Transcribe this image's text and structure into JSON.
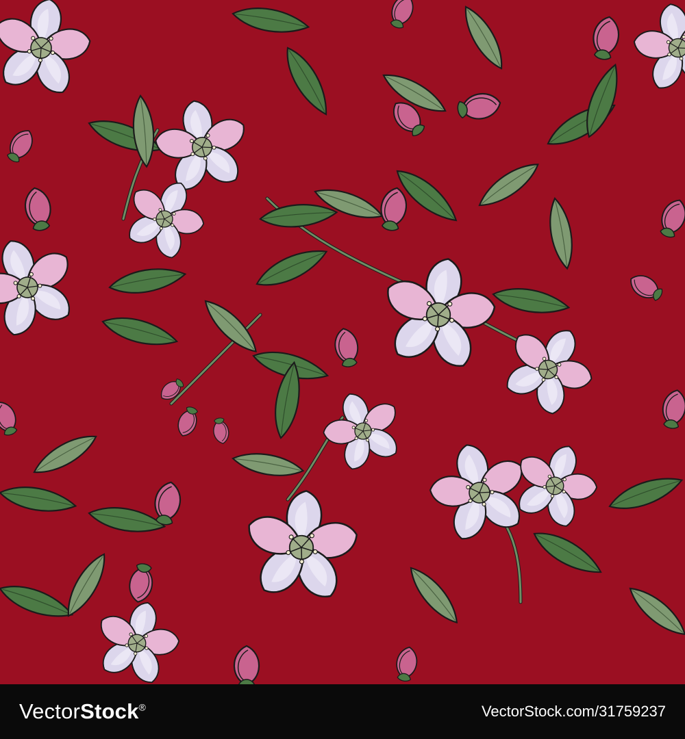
{
  "colors": {
    "background": "#9b0f22",
    "leaf": "#4c7a45",
    "leaf_light": "#7f9a72",
    "petal": "#dcd6ec",
    "petal_pink": "#e8b5d4",
    "bud": "#c9638f",
    "outline": "#1b1b1b",
    "footer_bg": "#0a0a0a",
    "footer_text": "#ffffff"
  },
  "watermark": {
    "logo_part1": "Vector",
    "logo_part2": "Stock",
    "logo_mark": "®",
    "credit": "VectorStock.com/31759237"
  }
}
